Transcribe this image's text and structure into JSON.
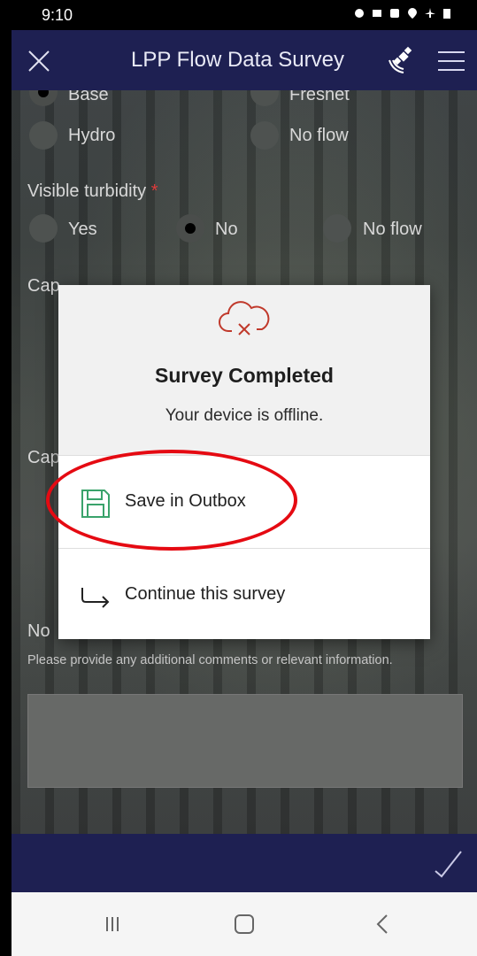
{
  "status_bar": {
    "time": "9:10"
  },
  "header": {
    "title": "LPP Flow Data Survey"
  },
  "form": {
    "q_flow_partial": {
      "options": [
        "Base",
        "Freshet",
        "Hydro",
        "No flow"
      ],
      "selected": "Base"
    },
    "turbidity": {
      "label": "Visible turbidity",
      "required_mark": "*",
      "options": [
        "Yes",
        "No",
        "No flow"
      ],
      "selected": "No"
    },
    "capture_photo_partial": "Cap",
    "capture_photo2_partial": "Cap",
    "notes_partial": "No",
    "notes_hint": "Please provide any additional comments or relevant information."
  },
  "dialog": {
    "title": "Survey Completed",
    "subtitle": "Your device is offline.",
    "options": [
      {
        "label": "Save in Outbox",
        "icon": "save-icon"
      },
      {
        "label": "Continue this survey",
        "icon": "arrow-right-icon"
      }
    ]
  },
  "colors": {
    "header_bg": "#1e2052",
    "highlight": "#e50a12",
    "icon_green": "#3aa36b",
    "icon_red": "#c0392b"
  }
}
